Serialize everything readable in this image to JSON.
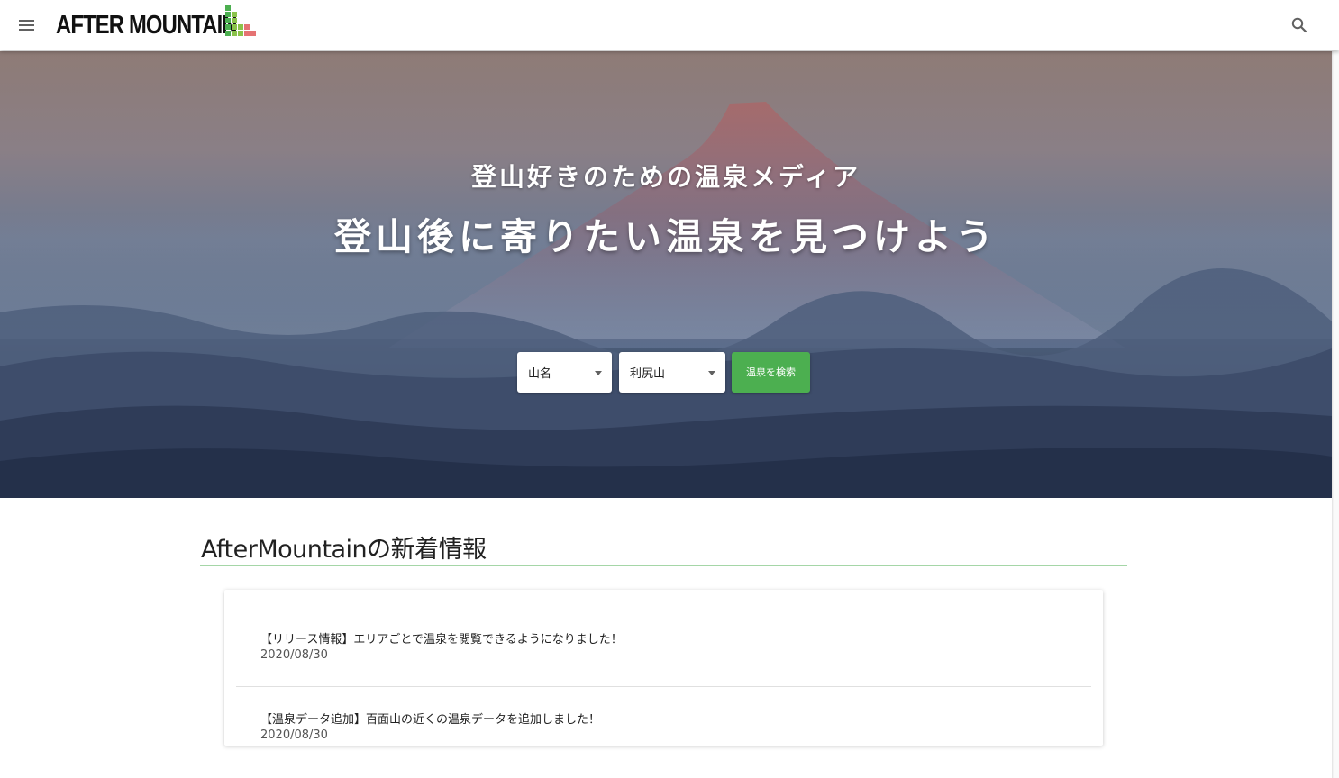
{
  "header": {
    "logo_text": "AFTER MOUNTAIN",
    "menu_icon": "hamburger-menu-icon",
    "search_icon": "magnifier-search-icon",
    "logo_colors": [
      "#4caf50",
      "#8bc34a",
      "#e57373"
    ]
  },
  "hero": {
    "subtitle": "登山好きのための温泉メディア",
    "title": "登山後に寄りたい温泉を見つけよう",
    "select_type": "山名",
    "select_mountain": "利尻山",
    "search_button": "温泉を検索",
    "accent_color": "#4caf50"
  },
  "news": {
    "heading": "AfterMountainの新着情報",
    "items": [
      {
        "title": "【リリース情報】エリアごとで温泉を閲覧できるようになりました！",
        "date": "2020/08/30"
      },
      {
        "title": "【温泉データ追加】百面山の近くの温泉データを追加しました！",
        "date": "2020/08/30"
      }
    ]
  }
}
